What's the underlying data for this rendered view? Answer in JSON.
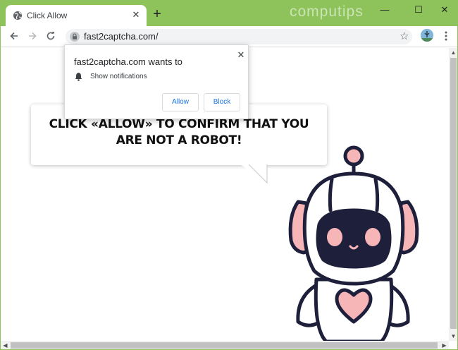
{
  "browser": {
    "tab_title": "Click Allow",
    "tab_close": "✕",
    "new_tab": "+",
    "watermark": "computips",
    "url": "fast2captcha.com/",
    "window_controls": {
      "minimize": "—",
      "maximize": "☐",
      "close": "✕"
    },
    "icons": [
      "globe-icon",
      "back-arrow-icon",
      "forward-arrow-icon",
      "reload-icon",
      "lock-icon",
      "star-icon",
      "avatar",
      "kebab-menu-icon"
    ]
  },
  "page": {
    "headline_line1": "CLICK «ALLOW» TO CONFIRM THAT YOU",
    "headline_line2": "ARE NOT A ROBOT!"
  },
  "permission_popup": {
    "title": "fast2captcha.com wants to",
    "permission": "Show notifications",
    "allow_label": "Allow",
    "block_label": "Block",
    "close": "✕"
  },
  "colors": {
    "titlebar": "#8dc35a",
    "accent_blue": "#1a73e8",
    "robot_outline": "#1e1f3a",
    "robot_pink": "#f6b6b8"
  }
}
